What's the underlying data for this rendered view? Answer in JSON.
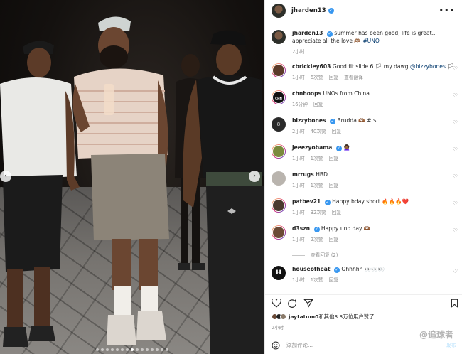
{
  "post": {
    "username": "jharden13",
    "caption_username": "jharden13",
    "caption_text": "summer has been good, life is great... appreciate all the love 🫶🏽",
    "caption_hashtag": "#UNO",
    "caption_time": "2小时"
  },
  "comments": [
    {
      "username": "cbrickley603",
      "pre": "Good fit slide 6 🏳 my dawg ",
      "mention": "@bizzybones",
      "post": " 🏳",
      "time": "1小时",
      "likes": "6次赞",
      "reply": "回复",
      "translate": "查看翻译",
      "verified": false
    },
    {
      "username": "chnhoops",
      "pre": "UNOs from China",
      "mention": "",
      "post": "",
      "time": "16分钟",
      "likes": "",
      "reply": "回复",
      "translate": "",
      "verified": false
    },
    {
      "username": "bizzybones",
      "pre": "Brudda 🫶🏾 # $",
      "mention": "",
      "post": "",
      "time": "2小时",
      "likes": "40次赞",
      "reply": "回复",
      "translate": "",
      "verified": true
    },
    {
      "username": "jeeezyobama",
      "pre": "👩🏾‍🦱",
      "mention": "",
      "post": "",
      "time": "1小时",
      "likes": "1次赞",
      "reply": "回复",
      "translate": "",
      "verified": true
    },
    {
      "username": "mrrugs",
      "pre": "HBD",
      "mention": "",
      "post": "",
      "time": "1小时",
      "likes": "1次赞",
      "reply": "回复",
      "translate": "",
      "verified": false
    },
    {
      "username": "patbev21",
      "pre": "Happy bday short 🔥🔥🔥❤️",
      "mention": "",
      "post": "",
      "time": "1小时",
      "likes": "32次赞",
      "reply": "回复",
      "translate": "",
      "verified": true
    },
    {
      "username": "d3szn",
      "pre": "Happy uno day 🫶🏾",
      "mention": "",
      "post": "",
      "time": "1小时",
      "likes": "2次赞",
      "reply": "回复",
      "translate": "",
      "verified": true
    },
    {
      "username": "houseofheat",
      "pre": "Ohhhhh 👀👀👀",
      "mention": "",
      "post": "",
      "time": "1小时",
      "likes": "1次赞",
      "reply": "回复",
      "translate": "",
      "verified": true
    }
  ],
  "view_replies": "查看回复 (2)",
  "avatar_labels": {
    "bizzybones": "8",
    "chnhoops": "CHN HOOPS",
    "houseofheat": "H"
  },
  "likes_summary": {
    "prefix": "jaytatum0",
    "text": "和其他3.3万位用户赞了"
  },
  "likes_time": "2小时",
  "add_comment_placeholder": "添加评论...",
  "post_button": "发布",
  "watermark": "@追球者",
  "icons": [
    "heart-icon",
    "comment-icon",
    "share-icon",
    "bookmark-icon",
    "more-icon",
    "emoji-icon",
    "verified-icon",
    "prev-arrow-icon",
    "next-arrow-icon"
  ],
  "colors": {
    "accent_blue": "#3897f0",
    "link": "#00376b",
    "muted": "#8e8e8e",
    "text": "#262626"
  },
  "carousel": {
    "slides": 15,
    "active": 7
  }
}
